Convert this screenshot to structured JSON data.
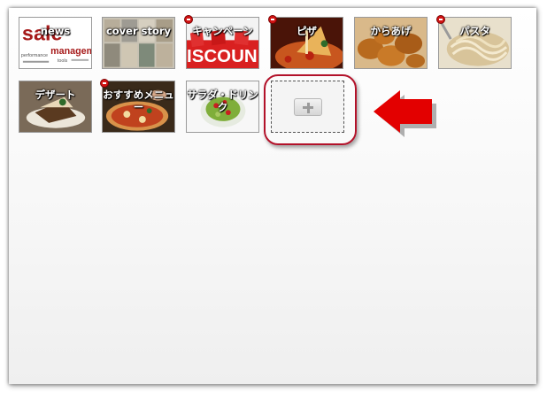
{
  "menu_tiles": [
    {
      "label": "news",
      "image": "sale-word-cloud-thumbnail",
      "image_text": [
        "sale",
        "management",
        "performance",
        "tools"
      ]
    },
    {
      "label": "cover story",
      "image": "cover-story-photo-grid-thumbnail"
    },
    {
      "label": "キャンペーン",
      "image": "discount-tags-thumbnail",
      "image_text": "ISCOUN"
    },
    {
      "label": "ピザ",
      "image": "pizza-slice-thumbnail"
    },
    {
      "label": "からあげ",
      "image": "fried-chicken-thumbnail"
    },
    {
      "label": "パスタ",
      "image": "pasta-thumbnail"
    },
    {
      "label": "デザート",
      "image": "dessert-thumbnail"
    },
    {
      "label": "おすすめメニュー",
      "image": "recommended-pizza-thumbnail"
    },
    {
      "label": "サラダ・ドリンク",
      "image": "salad-thumbnail"
    }
  ],
  "add_tile": {
    "icon": "plus-icon"
  },
  "annotation": {
    "arrow_icon": "red-arrow-icon",
    "highlight_color": "#b3122a",
    "arrow_color": "#e30000"
  },
  "colors": {
    "remove_badge": "#d21414"
  }
}
